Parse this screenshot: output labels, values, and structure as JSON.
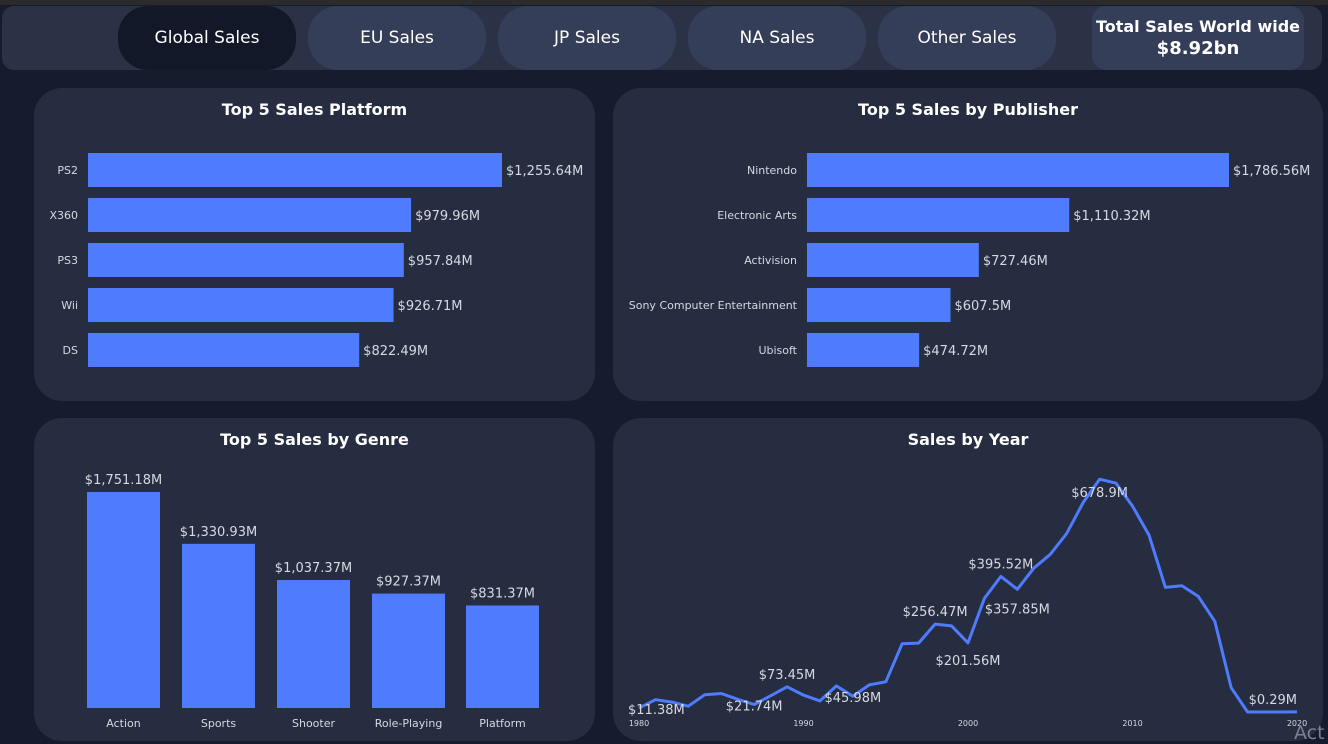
{
  "nav": {
    "tabs": [
      {
        "label": "Global Sales",
        "active": true
      },
      {
        "label": "EU Sales",
        "active": false
      },
      {
        "label": "JP Sales",
        "active": false
      },
      {
        "label": "NA Sales",
        "active": false
      },
      {
        "label": "Other Sales",
        "active": false
      }
    ],
    "total_label": "Total Sales World wide",
    "total_value": "$8.92bn"
  },
  "watermark": "Act",
  "colors": {
    "bar": "#4f7bff",
    "line": "#4f7bff",
    "page_bg": "#161c2e",
    "panel_bg": "#262d40",
    "tab_bg": "#353e58",
    "tab_active_bg": "#121828"
  },
  "chart_data": [
    {
      "type": "bar",
      "orientation": "horizontal",
      "title": "Top 5 Sales Platform",
      "categories": [
        "PS2",
        "X360",
        "PS3",
        "Wii",
        "DS"
      ],
      "values": [
        1255.64,
        979.96,
        957.84,
        926.71,
        822.49
      ],
      "data_labels": [
        "$1,255.64M",
        "$979.96M",
        "$957.84M",
        "$926.71M",
        "$822.49M"
      ],
      "unit": "M"
    },
    {
      "type": "bar",
      "orientation": "horizontal",
      "title": "Top 5 Sales by Publisher",
      "categories": [
        "Nintendo",
        "Electronic Arts",
        "Activision",
        "Sony Computer Entertainment",
        "Ubisoft"
      ],
      "values": [
        1786.56,
        1110.32,
        727.46,
        607.5,
        474.72
      ],
      "data_labels": [
        "$1,786.56M",
        "$1,110.32M",
        "$727.46M",
        "$607.5M",
        "$474.72M"
      ],
      "unit": "M"
    },
    {
      "type": "bar",
      "orientation": "vertical",
      "title": "Top 5 Sales by Genre",
      "categories": [
        "Action",
        "Sports",
        "Shooter",
        "Role-Playing",
        "Platform"
      ],
      "values": [
        1751.18,
        1330.93,
        1037.37,
        927.37,
        831.37
      ],
      "data_labels": [
        "$1,751.18M",
        "$1,330.93M",
        "$1,037.37M",
        "$927.37M",
        "$831.37M"
      ],
      "unit": "M"
    },
    {
      "type": "line",
      "title": "Sales by Year",
      "x": [
        1980,
        1981,
        1982,
        1983,
        1984,
        1985,
        1986,
        1987,
        1988,
        1989,
        1990,
        1991,
        1992,
        1993,
        1994,
        1995,
        1996,
        1997,
        1998,
        1999,
        2000,
        2001,
        2002,
        2003,
        2004,
        2005,
        2006,
        2007,
        2008,
        2009,
        2010,
        2011,
        2012,
        2013,
        2014,
        2015,
        2016,
        2017,
        2018,
        2019,
        2020
      ],
      "values": [
        11.38,
        35.77,
        28.86,
        16.79,
        50.36,
        53.94,
        37.07,
        21.74,
        47.22,
        73.45,
        49.39,
        32.23,
        76.16,
        45.98,
        79.17,
        88.11,
        199.15,
        200.98,
        256.47,
        251.27,
        201.56,
        331.47,
        395.52,
        357.85,
        419.31,
        459.94,
        521.04,
        611.13,
        678.9,
        667.3,
        600.45,
        515.99,
        363.54,
        368.11,
        337.05,
        264.44,
        70.93,
        0.05,
        0.0,
        0.0,
        0.29
      ],
      "annotations": [
        {
          "x": 1980,
          "label": "$11.38M"
        },
        {
          "x": 1987,
          "label": "$21.74M"
        },
        {
          "x": 1989,
          "label": "$73.45M"
        },
        {
          "x": 1993,
          "label": "$45.98M"
        },
        {
          "x": 1998,
          "label": "$256.47M"
        },
        {
          "x": 2000,
          "label": "$201.56M"
        },
        {
          "x": 2002,
          "label": "$395.52M"
        },
        {
          "x": 2003,
          "label": "$357.85M"
        },
        {
          "x": 2008,
          "label": "$678.9M"
        },
        {
          "x": 2020,
          "label": "$0.29M"
        }
      ],
      "x_ticks": [
        1980,
        1990,
        2000,
        2010,
        2020
      ],
      "xlim": [
        1980,
        2020
      ],
      "ylim": [
        0,
        700
      ],
      "grid": false
    }
  ]
}
